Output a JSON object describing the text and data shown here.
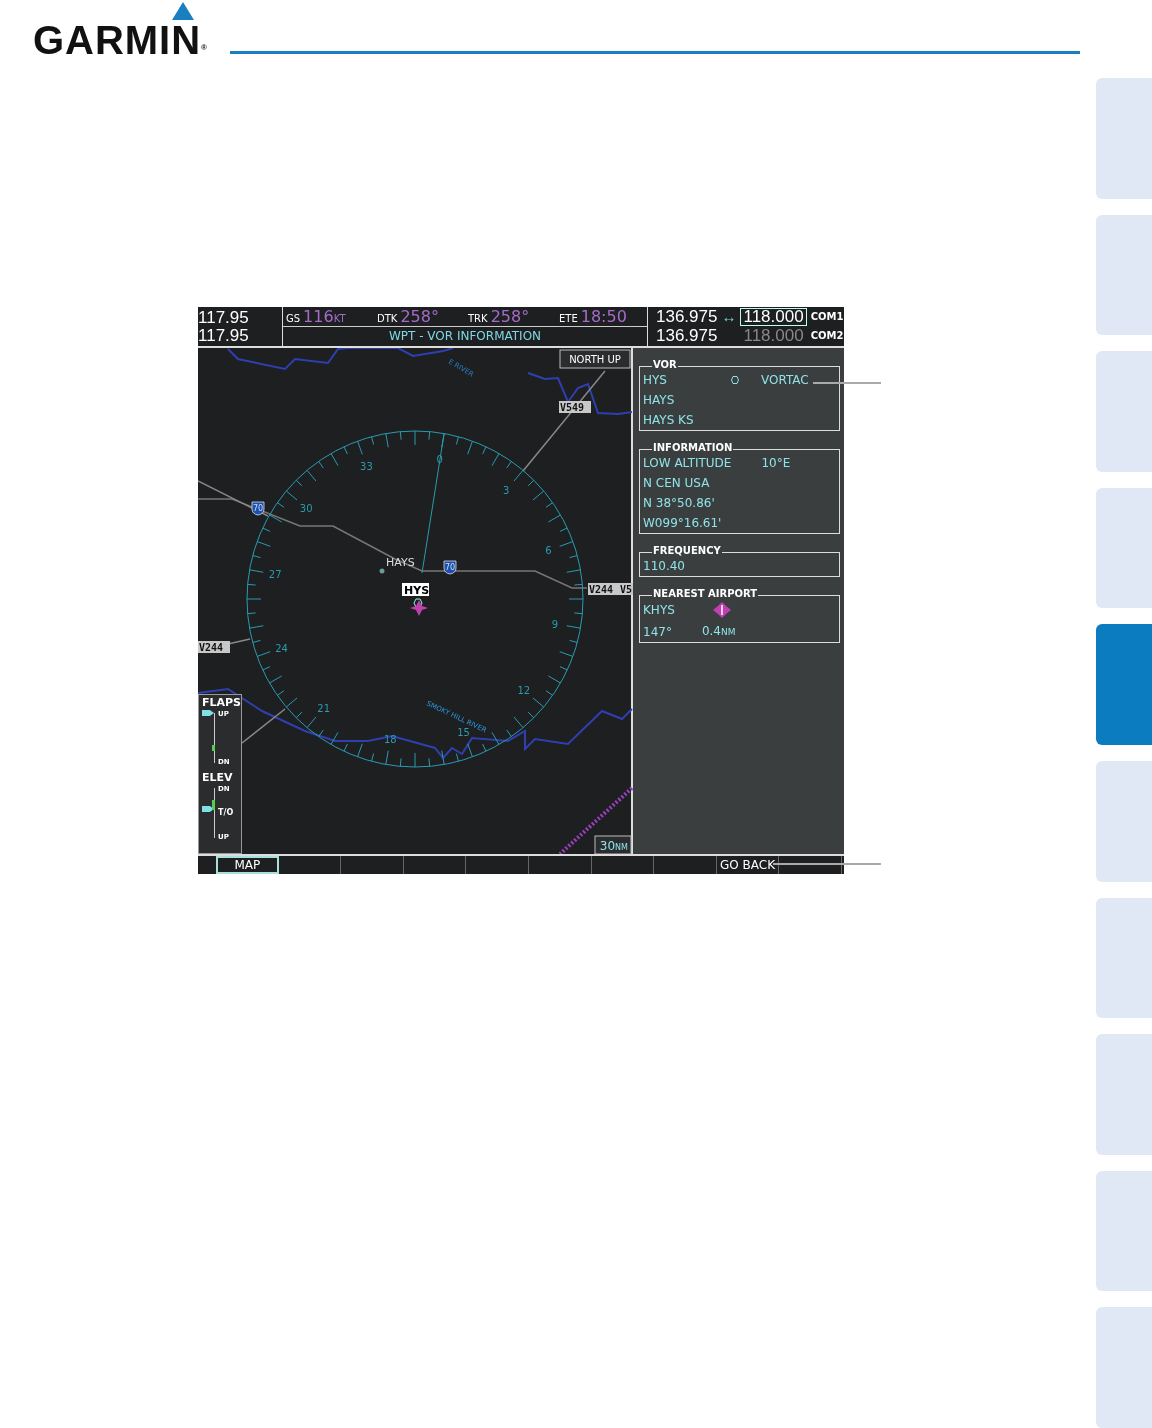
{
  "logo": {
    "text": "GARMIN",
    "mark": "®"
  },
  "side_tabs": [
    {
      "selected": false
    },
    {
      "selected": false
    },
    {
      "selected": false
    },
    {
      "selected": false
    },
    {
      "selected": true
    },
    {
      "selected": false
    },
    {
      "selected": false
    },
    {
      "selected": false
    },
    {
      "selected": false
    },
    {
      "selected": false
    }
  ],
  "screen": {
    "nav": [
      "117.95",
      "117.95"
    ],
    "data_fields": [
      {
        "label": "GS",
        "value": "116",
        "unit": "KT"
      },
      {
        "label": "DTK",
        "value": "258°"
      },
      {
        "label": "TRK",
        "value": "258°"
      },
      {
        "label": "ETE",
        "value": "18:50"
      }
    ],
    "page_title": "WPT - VOR INFORMATION",
    "com": [
      {
        "standby": "136.975",
        "transfer": "↔",
        "active": "118.000",
        "label": "COM1",
        "selected": true
      },
      {
        "standby": "136.975",
        "active": "118.000",
        "label": "COM2",
        "selected": false
      }
    ],
    "map": {
      "orientation": "NORTH UP",
      "range": {
        "value": "30",
        "unit": "NM"
      },
      "compass_labels": [
        "0",
        "3",
        "6",
        "9",
        "12",
        "15",
        "18",
        "21",
        "24",
        "27",
        "30",
        "33"
      ],
      "airway_labels": [
        "V549",
        "V244",
        "V244",
        "V5"
      ],
      "highway_shields": [
        "70",
        "70"
      ],
      "city": "HAYS",
      "vor_label": "HYS",
      "rivers": [
        "E RIVER",
        "SMOKY HILL RIVER"
      ],
      "flaps": {
        "title": "FLAPS",
        "top": "UP",
        "bottom": "DN",
        "level": 1
      },
      "elevator": {
        "title": "ELEV",
        "top": "DN",
        "middle": "T/O",
        "bottom": "UP",
        "level": 0.58
      }
    },
    "sections": [
      {
        "title": "VOR",
        "rows": [
          [
            {
              "kind": "text",
              "text": "HYS"
            },
            {
              "kind": "vor_symbol"
            },
            {
              "kind": "text",
              "text": "VORTAC"
            }
          ],
          [
            {
              "kind": "text",
              "text": "HAYS"
            }
          ],
          [
            {
              "kind": "text",
              "text": "HAYS KS"
            }
          ]
        ]
      },
      {
        "title": "INFORMATION",
        "rows": [
          [
            {
              "kind": "text",
              "text": "LOW ALTITUDE"
            },
            {
              "kind": "text",
              "text": "10°E"
            }
          ],
          [
            {
              "kind": "text",
              "text": "N CEN USA"
            }
          ],
          [
            {
              "kind": "text",
              "text": "N 38°50.86'"
            }
          ],
          [
            {
              "kind": "text",
              "text": "W099°16.61'"
            }
          ]
        ]
      },
      {
        "title": "FREQUENCY",
        "rows": [
          [
            {
              "kind": "text",
              "text": "110.40"
            }
          ]
        ]
      },
      {
        "title": "NEAREST AIRPORT",
        "rows": [
          [
            {
              "kind": "text",
              "text": "KHYS"
            },
            {
              "kind": "airport_symbol"
            }
          ],
          [
            {
              "kind": "text",
              "text": "147°"
            },
            {
              "kind": "distance",
              "value": "0.4",
              "unit": "NM"
            }
          ]
        ]
      }
    ],
    "softkeys": [
      {
        "kind": "key",
        "label": "MAP",
        "selected": true
      },
      {
        "kind": "blank"
      },
      {
        "kind": "blank"
      },
      {
        "kind": "blank"
      },
      {
        "kind": "blank"
      },
      {
        "kind": "blank"
      },
      {
        "kind": "blank"
      },
      {
        "kind": "blank"
      },
      {
        "kind": "key",
        "label": "GO BACK",
        "selected": false
      },
      {
        "kind": "blank"
      }
    ]
  }
}
